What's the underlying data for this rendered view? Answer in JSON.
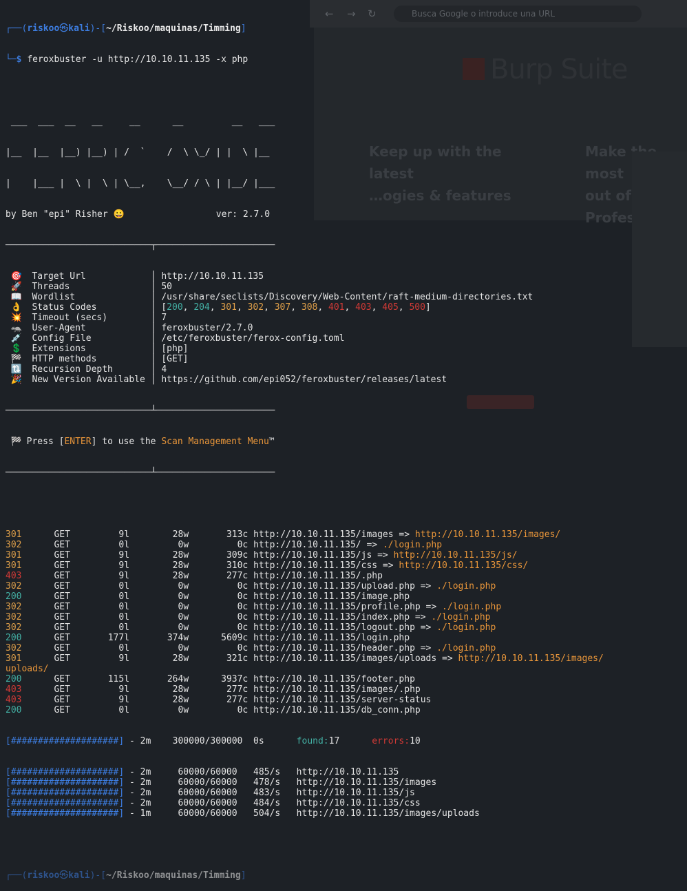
{
  "browser": {
    "url_hint": "Busca Google o introduce una URL",
    "logo": "Burp Suite",
    "col1": [
      "Keep up with the",
      "latest",
      "…ogies & features"
    ],
    "col2": [
      "Make the most",
      "out of",
      "Profes…"
    ]
  },
  "terminal": {
    "prompt": {
      "user": "riskoo",
      "host": "kali",
      "path": "~/Riskoo/maquinas/Timming"
    },
    "command": "feroxbuster -u http://10.10.11.135 -x php",
    "banner": [
      " ___  ___  __   __     __      __         __   ___",
      "|__  |__  |__) |__) | /  `    /  \\ \\_/ | |  \\ |__",
      "|    |___ |  \\ |  \\ | \\__,    \\__/ / \\ | |__/ |___",
      "by Ben \"epi\" Risher 😀                 ver: 2.7.0"
    ],
    "rule": "───────────────────────────┬──────────────────────",
    "rule_bottom": "───────────────────────────┴──────────────────────",
    "config": [
      {
        "icon": "🎯",
        "key": "Target Url",
        "value": "http://10.10.11.135"
      },
      {
        "icon": "🚀",
        "key": "Threads",
        "value": "50"
      },
      {
        "icon": "📖",
        "key": "Wordlist",
        "value": "/usr/share/seclists/Discovery/Web-Content/raft-medium-directories.txt"
      },
      {
        "icon": "👌",
        "key": "Status Codes",
        "value": ""
      },
      {
        "icon": "💥",
        "key": "Timeout (secs)",
        "value": "7"
      },
      {
        "icon": "🦡",
        "key": "User-Agent",
        "value": "feroxbuster/2.7.0"
      },
      {
        "icon": "💉",
        "key": "Config File",
        "value": "/etc/feroxbuster/ferox-config.toml"
      },
      {
        "icon": "💲",
        "key": "Extensions",
        "value": "[php]"
      },
      {
        "icon": "🏁",
        "key": "HTTP methods",
        "value": "[GET]"
      },
      {
        "icon": "🔃",
        "key": "Recursion Depth",
        "value": "4"
      },
      {
        "icon": "🎉",
        "key": "New Version Available",
        "value": "https://github.com/epi052/feroxbuster/releases/latest"
      }
    ],
    "status_codes": [
      {
        "code": "200",
        "color": "#43b0a4"
      },
      {
        "code": "204",
        "color": "#43b0a4"
      },
      {
        "code": "301",
        "color": "#e0a04a"
      },
      {
        "code": "302",
        "color": "#e0a04a"
      },
      {
        "code": "307",
        "color": "#e0a04a"
      },
      {
        "code": "308",
        "color": "#e0a04a"
      },
      {
        "code": "401",
        "color": "#d23a36"
      },
      {
        "code": "403",
        "color": "#d23a36"
      },
      {
        "code": "405",
        "color": "#d23a36"
      },
      {
        "code": "500",
        "color": "#d23a36"
      }
    ],
    "press": {
      "icon": "🏁",
      "pre": "Press [",
      "key": "ENTER",
      "mid": "] to use the ",
      "menu": "Scan Management Menu",
      "post": "™"
    },
    "results": [
      {
        "code": "301",
        "method": "GET",
        "lines": "9l",
        "words": "28w",
        "chars": "313c",
        "url": "http://10.10.11.135/images",
        "redirect": "http://10.10.11.135/images/"
      },
      {
        "code": "302",
        "method": "GET",
        "lines": "0l",
        "words": "0w",
        "chars": "0c",
        "url": "http://10.10.11.135/",
        "redirect": "./login.php"
      },
      {
        "code": "301",
        "method": "GET",
        "lines": "9l",
        "words": "28w",
        "chars": "309c",
        "url": "http://10.10.11.135/js",
        "redirect": "http://10.10.11.135/js/"
      },
      {
        "code": "301",
        "method": "GET",
        "lines": "9l",
        "words": "28w",
        "chars": "310c",
        "url": "http://10.10.11.135/css",
        "redirect": "http://10.10.11.135/css/"
      },
      {
        "code": "403",
        "method": "GET",
        "lines": "9l",
        "words": "28w",
        "chars": "277c",
        "url": "http://10.10.11.135/.php",
        "redirect": ""
      },
      {
        "code": "302",
        "method": "GET",
        "lines": "0l",
        "words": "0w",
        "chars": "0c",
        "url": "http://10.10.11.135/upload.php",
        "redirect": "./login.php"
      },
      {
        "code": "200",
        "method": "GET",
        "lines": "0l",
        "words": "0w",
        "chars": "0c",
        "url": "http://10.10.11.135/image.php",
        "redirect": ""
      },
      {
        "code": "302",
        "method": "GET",
        "lines": "0l",
        "words": "0w",
        "chars": "0c",
        "url": "http://10.10.11.135/profile.php",
        "redirect": "./login.php"
      },
      {
        "code": "302",
        "method": "GET",
        "lines": "0l",
        "words": "0w",
        "chars": "0c",
        "url": "http://10.10.11.135/index.php",
        "redirect": "./login.php"
      },
      {
        "code": "302",
        "method": "GET",
        "lines": "0l",
        "words": "0w",
        "chars": "0c",
        "url": "http://10.10.11.135/logout.php",
        "redirect": "./login.php"
      },
      {
        "code": "200",
        "method": "GET",
        "lines": "177l",
        "words": "374w",
        "chars": "5609c",
        "url": "http://10.10.11.135/login.php",
        "redirect": ""
      },
      {
        "code": "302",
        "method": "GET",
        "lines": "0l",
        "words": "0w",
        "chars": "0c",
        "url": "http://10.10.11.135/header.php",
        "redirect": "./login.php"
      },
      {
        "code": "301",
        "method": "GET",
        "lines": "9l",
        "words": "28w",
        "chars": "321c",
        "url": "http://10.10.11.135/images/uploads",
        "redirect": "http://10.10.11.135/images/uploads/"
      },
      {
        "code": "200",
        "method": "GET",
        "lines": "115l",
        "words": "264w",
        "chars": "3937c",
        "url": "http://10.10.11.135/footer.php",
        "redirect": ""
      },
      {
        "code": "403",
        "method": "GET",
        "lines": "9l",
        "words": "28w",
        "chars": "277c",
        "url": "http://10.10.11.135/images/.php",
        "redirect": ""
      },
      {
        "code": "403",
        "method": "GET",
        "lines": "9l",
        "words": "28w",
        "chars": "277c",
        "url": "http://10.10.11.135/server-status",
        "redirect": ""
      },
      {
        "code": "200",
        "method": "GET",
        "lines": "0l",
        "words": "0w",
        "chars": "0c",
        "url": "http://10.10.11.135/db_conn.php",
        "redirect": ""
      }
    ],
    "progress_main": {
      "bar": "[####################]",
      "time": "2m",
      "count": "300000/300000",
      "eta": "0s",
      "found_label": "found:",
      "found": "17",
      "errors_label": "errors:",
      "errors": "10"
    },
    "progress": [
      {
        "bar": "[####################]",
        "time": "2m",
        "count": "60000/60000",
        "rate": "485/s",
        "url": "http://10.10.11.135"
      },
      {
        "bar": "[####################]",
        "time": "2m",
        "count": "60000/60000",
        "rate": "478/s",
        "url": "http://10.10.11.135/images"
      },
      {
        "bar": "[####################]",
        "time": "2m",
        "count": "60000/60000",
        "rate": "483/s",
        "url": "http://10.10.11.135/js"
      },
      {
        "bar": "[####################]",
        "time": "2m",
        "count": "60000/60000",
        "rate": "484/s",
        "url": "http://10.10.11.135/css"
      },
      {
        "bar": "[####################]",
        "time": "1m",
        "count": "60000/60000",
        "rate": "504/s",
        "url": "http://10.10.11.135/images/uploads"
      }
    ]
  }
}
